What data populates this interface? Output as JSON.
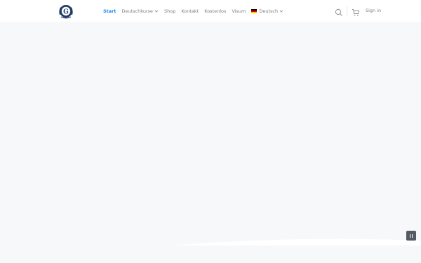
{
  "header": {
    "logo_icon": "laurel-g-logo-icon",
    "nav": [
      {
        "label": "Start",
        "active": true,
        "dropdown": false
      },
      {
        "label": "Deutschkurse",
        "active": false,
        "dropdown": true
      },
      {
        "label": "Shop",
        "active": false,
        "dropdown": false
      },
      {
        "label": "Kontakt",
        "active": false,
        "dropdown": false
      },
      {
        "label": "Kostenlos",
        "active": false,
        "dropdown": false
      },
      {
        "label": "Visum",
        "active": false,
        "dropdown": false
      },
      {
        "label": "Deutsch",
        "active": false,
        "dropdown": true,
        "flag": "germany-flag-icon"
      }
    ],
    "search_icon": "search-icon",
    "cart_icon": "cart-icon",
    "signin_label": "Sign in"
  },
  "hero": {
    "pause_icon": "pause-icon"
  },
  "colors": {
    "accent": "#1e88e5",
    "nav_text": "#7a8088",
    "hero_bg": "#f7f8fa",
    "pause_bg": "#555a60"
  }
}
